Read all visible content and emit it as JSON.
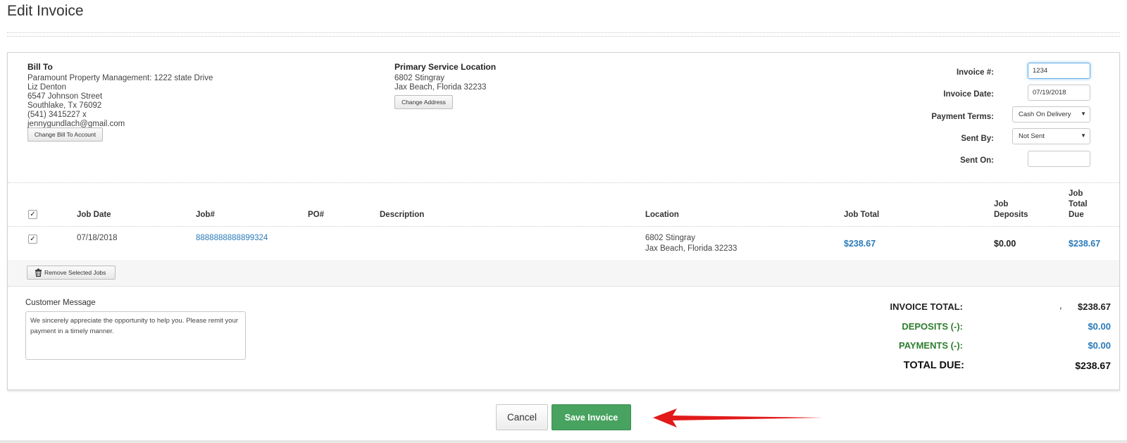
{
  "page": {
    "title": "Edit Invoice"
  },
  "bill_to": {
    "heading": "Bill To",
    "lines": [
      "Paramount Property Management: 1222 state Drive",
      "Liz Denton",
      "6547 Johnson Street",
      "Southlake, Tx 76092",
      "(541) 3415227 x",
      "jennygundlach@gmail.com"
    ],
    "change_button": "Change Bill To Account"
  },
  "service_location": {
    "heading": "Primary Service Location",
    "lines": [
      "6802 Stingray",
      "Jax Beach, Florida 32233"
    ],
    "change_button": "Change Address"
  },
  "invoice_form": {
    "invoice_no_label": "Invoice #:",
    "invoice_no_value": "1234",
    "invoice_date_label": "Invoice Date:",
    "invoice_date_value": "07/19/2018",
    "payment_terms_label": "Payment Terms:",
    "payment_terms_value": "Cash On Delivery",
    "sent_by_label": "Sent By:",
    "sent_by_value": "Not Sent",
    "sent_on_label": "Sent On:",
    "sent_on_value": ""
  },
  "jobs_table": {
    "headers": {
      "job_date": "Job Date",
      "job_no": "Job#",
      "po_no": "PO#",
      "description": "Description",
      "location": "Location",
      "job_total": "Job Total",
      "job_deposits": [
        "Job",
        "Deposits"
      ],
      "job_total_due": [
        "Job",
        "Total",
        "Due"
      ]
    },
    "rows": [
      {
        "checked": "✓",
        "job_date": "07/18/2018",
        "job_no": "8888888888899324",
        "po_no": "",
        "description": "",
        "location": [
          "6802 Stingray",
          "Jax Beach, Florida 32233"
        ],
        "job_total": "$238.67",
        "job_deposits": "$0.00",
        "job_total_due": "$238.67"
      }
    ],
    "header_check": "✓",
    "remove_button": "Remove Selected Jobs"
  },
  "customer_message": {
    "label": "Customer Message",
    "text": "We sincerely appreciate the opportunity to help you.  Please remit your payment in a timely manner."
  },
  "totals": {
    "invoice_total_label": "INVOICE TOTAL:",
    "invoice_total_prefix": ",",
    "invoice_total_value": "$238.67",
    "deposits_label": "DEPOSITS (-):",
    "deposits_value": "$0.00",
    "payments_label": "PAYMENTS (-):",
    "payments_value": "$0.00",
    "total_due_label": "TOTAL DUE:",
    "total_due_value": "$238.67"
  },
  "actions": {
    "cancel": "Cancel",
    "save": "Save Invoice"
  },
  "colors": {
    "link": "#2a7ab9",
    "green_label": "#2e7d2e",
    "save_button": "#47a35f",
    "arrow": "#e21a1a"
  },
  "icons": {
    "trash": "trash-icon",
    "caret": "caret-down-icon",
    "arrow": "red-arrow-annotation"
  }
}
